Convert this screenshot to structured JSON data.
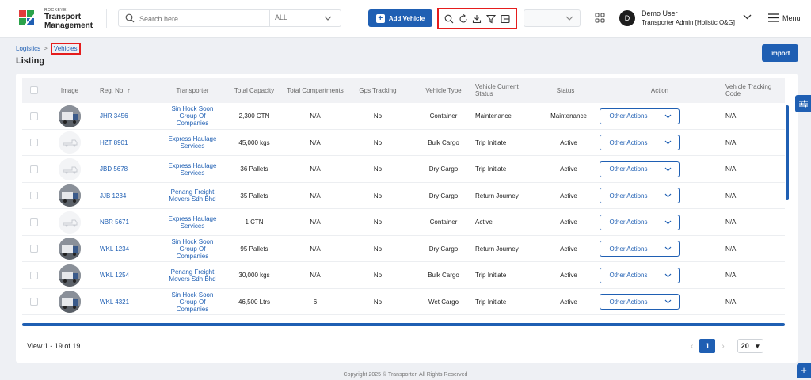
{
  "app": {
    "brand_small": "ROCKEYE",
    "brand_line1": "Transport",
    "brand_line2": "Management"
  },
  "header": {
    "search_placeholder": "Search here",
    "search_scope": "ALL",
    "add_vehicle_label": "Add Vehicle",
    "toolbar_icons": [
      "search-icon",
      "refresh-icon",
      "download-icon",
      "filter-icon",
      "columns-icon"
    ],
    "user_initial": "D",
    "user_name": "Demo User",
    "user_role": "Transporter Admin [Holistic O&G]",
    "menu_label": "Menu"
  },
  "breadcrumb": {
    "parent": "Logistics",
    "separator": ">",
    "current": "Vehicles"
  },
  "page": {
    "title": "Listing",
    "import_label": "Import"
  },
  "table": {
    "headers": {
      "image": "Image",
      "reg": "Reg. No.",
      "reg_sort": "↑",
      "transporter": "Transporter",
      "capacity": "Total Capacity",
      "compartments": "Total Compartments",
      "gps": "Gps Tracking",
      "type": "Vehicle Type",
      "current_status_1": "Vehicle Current",
      "current_status_2": "Status",
      "status": "Status",
      "action": "Action",
      "tracking_1": "Vehicle Tracking",
      "tracking_2": "Code"
    },
    "action_label": "Other Actions",
    "rows": [
      {
        "reg": "JHR 3456",
        "t1": "Sin Hock Soon",
        "t2": "Group Of",
        "t3": "Companies",
        "capacity": "2,300 CTN",
        "compartments": "N/A",
        "gps": "No",
        "type": "Container",
        "current": "Maintenance",
        "status": "Maintenance",
        "tracking": "N/A",
        "img": "photo"
      },
      {
        "reg": "HZT 8901",
        "t1": "Express Haulage",
        "t2": "Services",
        "t3": "",
        "capacity": "45,000 kgs",
        "compartments": "N/A",
        "gps": "No",
        "type": "Bulk Cargo",
        "current": "Trip Initiate",
        "status": "Active",
        "tracking": "N/A",
        "img": "placeholder"
      },
      {
        "reg": "JBD 5678",
        "t1": "Express Haulage",
        "t2": "Services",
        "t3": "",
        "capacity": "36 Pallets",
        "compartments": "N/A",
        "gps": "No",
        "type": "Dry Cargo",
        "current": "Trip Initiate",
        "status": "Active",
        "tracking": "N/A",
        "img": "placeholder"
      },
      {
        "reg": "JJB 1234",
        "t1": "Penang Freight",
        "t2": "Movers Sdn Bhd",
        "t3": "",
        "capacity": "35 Pallets",
        "compartments": "N/A",
        "gps": "No",
        "type": "Dry Cargo",
        "current": "Return Journey",
        "status": "Active",
        "tracking": "N/A",
        "img": "photo"
      },
      {
        "reg": "NBR 5671",
        "t1": "Express Haulage",
        "t2": "Services",
        "t3": "",
        "capacity": "1 CTN",
        "compartments": "N/A",
        "gps": "No",
        "type": "Container",
        "current": "Active",
        "status": "Active",
        "tracking": "N/A",
        "img": "placeholder"
      },
      {
        "reg": "WKL 1234",
        "t1": "Sin Hock Soon",
        "t2": "Group Of",
        "t3": "Companies",
        "capacity": "95 Pallets",
        "compartments": "N/A",
        "gps": "No",
        "type": "Dry Cargo",
        "current": "Return Journey",
        "status": "Active",
        "tracking": "N/A",
        "img": "photo"
      },
      {
        "reg": "WKL 1254",
        "t1": "Penang Freight",
        "t2": "Movers Sdn Bhd",
        "t3": "",
        "capacity": "30,000 kgs",
        "compartments": "N/A",
        "gps": "No",
        "type": "Bulk Cargo",
        "current": "Trip Initiate",
        "status": "Active",
        "tracking": "N/A",
        "img": "photo"
      },
      {
        "reg": "WKL 4321",
        "t1": "Sin Hock Soon",
        "t2": "Group Of",
        "t3": "Companies",
        "capacity": "46,500 Ltrs",
        "compartments": "6",
        "gps": "No",
        "type": "Wet Cargo",
        "current": "Trip Initiate",
        "status": "Active",
        "tracking": "N/A",
        "img": "photo"
      }
    ]
  },
  "footer": {
    "view_text": "View 1 - 19 of 19",
    "prev": "‹",
    "page": "1",
    "next": "›",
    "page_size": "20",
    "page_size_arrow": "▾",
    "copyright": "Copyright 2025 © Transporter. All Rights Reserved"
  },
  "colors": {
    "primary": "#1f5fb3",
    "highlight": "#e51d1d"
  }
}
